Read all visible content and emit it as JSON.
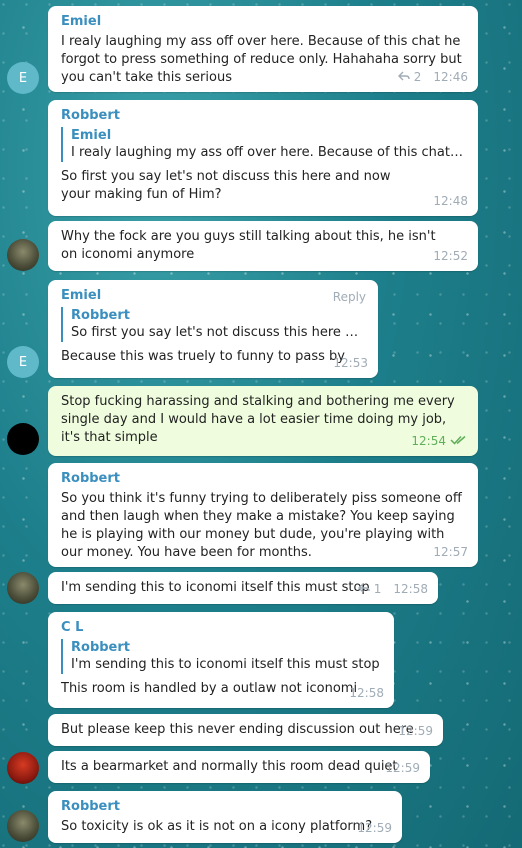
{
  "messages": [
    {
      "sender": "Emiel",
      "text": "I realy laughing my ass off over here. Because of this chat he forgot to press something of reduce only. Hahahaha sorry but you can't take this serious",
      "time": "12:46",
      "replies": "2"
    },
    {
      "sender": "Robbert",
      "quote_name": "Emiel",
      "quote_text": "I realy laughing my ass off over here. Because of this chat he fo...",
      "text": "So first you say let's not discuss this here and now your making fun of Him?",
      "time": "12:48"
    },
    {
      "text": "Why the fock are you guys still talking about this, he isn't on iconomi anymore",
      "time": "12:52"
    },
    {
      "sender": "Emiel",
      "reply_link": "Reply",
      "quote_name": "Robbert",
      "quote_text": "So first you say let's not discuss this here and ...",
      "text": "Because this was truely to funny to pass by",
      "time": "12:53"
    },
    {
      "text": "Stop fucking harassing and stalking and bothering me every single day and I would have a lot easier time doing my job, it's that simple",
      "time": "12:54"
    },
    {
      "sender": "Robbert",
      "text": "So you think it's funny trying to deliberately piss someone off and then laugh when they make a mistake? You keep saying he is playing with our money but dude, you're playing with our money. You have been for months.",
      "time": "12:57"
    },
    {
      "text": "I'm sending this to iconomi itself this must stop",
      "time": "12:58",
      "replies": "1"
    },
    {
      "sender": "C L",
      "quote_name": "Robbert",
      "quote_text": "I'm sending this to iconomi itself this must stop",
      "text": "This room is handled by a outlaw not iconomi",
      "time": "12:58"
    },
    {
      "text": "But please keep this never ending discussion out here",
      "time": "12:59"
    },
    {
      "text": "Its a bearmarket and normally this room dead quiet",
      "time": "12:59"
    },
    {
      "sender": "Robbert",
      "text": "So toxicity is ok as it is not on a icony platform?",
      "time": "12:59"
    }
  ],
  "avatars": {
    "emiel_letter": "E"
  },
  "colors": {
    "sender": "#3a8fbf",
    "own_bubble": "#effdde",
    "read_check": "#5fae5a"
  }
}
